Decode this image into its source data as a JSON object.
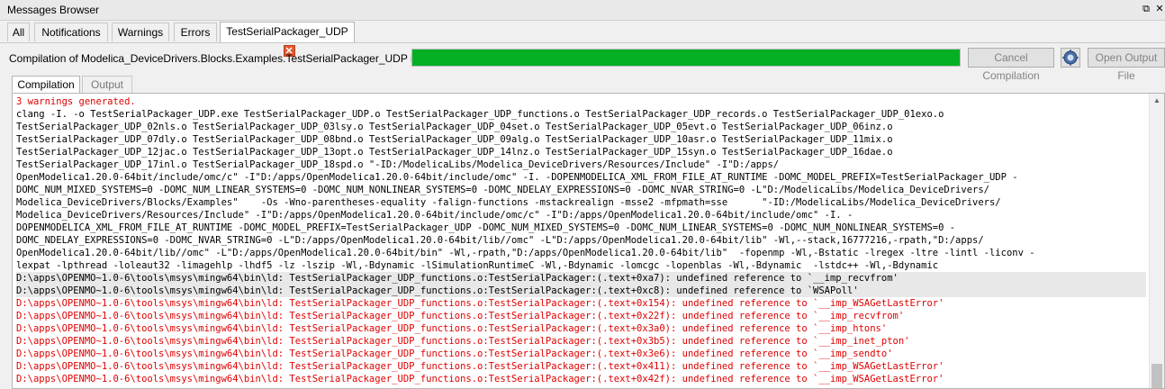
{
  "window": {
    "title": "Messages Browser"
  },
  "tabs": [
    {
      "label": "All"
    },
    {
      "label": "Notifications"
    },
    {
      "label": "Warnings"
    },
    {
      "label": "Errors"
    },
    {
      "label": "TestSerialPackager_UDP",
      "close_glyph": "✕"
    }
  ],
  "status": {
    "text": "Compilation of Modelica_DeviceDrivers.Blocks.Examples.TestSerialPackager_UDP is finished.",
    "progress_fraction": 1.0,
    "progress_color": "#06b025"
  },
  "buttons": {
    "cancel": "Cancel Compilation",
    "open_output": "Open Output File",
    "icon": "debug-icon"
  },
  "subtabs": [
    {
      "label": "Compilation"
    },
    {
      "label": "Output"
    }
  ],
  "colors": {
    "warning_text": "#e00000",
    "normal_text": "#000000"
  },
  "log": [
    {
      "text": "3 warnings generated.",
      "kind": "warn"
    },
    {
      "text": "clang -I. -o TestSerialPackager_UDP.exe TestSerialPackager_UDP.o TestSerialPackager_UDP_functions.o TestSerialPackager_UDP_records.o TestSerialPackager_UDP_01exo.o",
      "kind": "normal"
    },
    {
      "text": "TestSerialPackager_UDP_02nls.o TestSerialPackager_UDP_03lsy.o TestSerialPackager_UDP_04set.o TestSerialPackager_UDP_05evt.o TestSerialPackager_UDP_06inz.o",
      "kind": "normal"
    },
    {
      "text": "TestSerialPackager_UDP_07dly.o TestSerialPackager_UDP_08bnd.o TestSerialPackager_UDP_09alg.o TestSerialPackager_UDP_10asr.o TestSerialPackager_UDP_11mix.o",
      "kind": "normal"
    },
    {
      "text": "TestSerialPackager_UDP_12jac.o TestSerialPackager_UDP_13opt.o TestSerialPackager_UDP_14lnz.o TestSerialPackager_UDP_15syn.o TestSerialPackager_UDP_16dae.o",
      "kind": "normal"
    },
    {
      "text": "TestSerialPackager_UDP_17inl.o TestSerialPackager_UDP_18spd.o \"-ID:/ModelicaLibs/Modelica_DeviceDrivers/Resources/Include\" -I\"D:/apps/",
      "kind": "normal"
    },
    {
      "text": "OpenModelica1.20.0-64bit/include/omc/c\" -I\"D:/apps/OpenModelica1.20.0-64bit/include/omc\" -I. -DOPENMODELICA_XML_FROM_FILE_AT_RUNTIME -DOMC_MODEL_PREFIX=TestSerialPackager_UDP -",
      "kind": "normal"
    },
    {
      "text": "DOMC_NUM_MIXED_SYSTEMS=0 -DOMC_NUM_LINEAR_SYSTEMS=0 -DOMC_NUM_NONLINEAR_SYSTEMS=0 -DOMC_NDELAY_EXPRESSIONS=0 -DOMC_NVAR_STRING=0 -L\"D:/ModelicaLibs/Modelica_DeviceDrivers/",
      "kind": "normal"
    },
    {
      "text": "Modelica_DeviceDrivers/Blocks/Examples\"    -Os -Wno-parentheses-equality -falign-functions -mstackrealign -msse2 -mfpmath=sse      \"-ID:/ModelicaLibs/Modelica_DeviceDrivers/",
      "kind": "normal"
    },
    {
      "text": "Modelica_DeviceDrivers/Resources/Include\" -I\"D:/apps/OpenModelica1.20.0-64bit/include/omc/c\" -I\"D:/apps/OpenModelica1.20.0-64bit/include/omc\" -I. -",
      "kind": "normal"
    },
    {
      "text": "DOPENMODELICA_XML_FROM_FILE_AT_RUNTIME -DOMC_MODEL_PREFIX=TestSerialPackager_UDP -DOMC_NUM_MIXED_SYSTEMS=0 -DOMC_NUM_LINEAR_SYSTEMS=0 -DOMC_NUM_NONLINEAR_SYSTEMS=0 -",
      "kind": "normal"
    },
    {
      "text": "DOMC_NDELAY_EXPRESSIONS=0 -DOMC_NVAR_STRING=0 -L\"D:/apps/OpenModelica1.20.0-64bit/lib//omc\" -L\"D:/apps/OpenModelica1.20.0-64bit/lib\" -Wl,--stack,16777216,-rpath,\"D:/apps/",
      "kind": "normal"
    },
    {
      "text": "OpenModelica1.20.0-64bit/lib//omc\" -L\"D:/apps/OpenModelica1.20.0-64bit/bin\" -Wl,-rpath,\"D:/apps/OpenModelica1.20.0-64bit/lib\"  -fopenmp -Wl,-Bstatic -lregex -ltre -lintl -liconv -",
      "kind": "normal"
    },
    {
      "text": "lexpat -lpthread -loleaut32 -limagehlp -lhdf5 -lz -lszip -Wl,-Bdynamic -lSimulationRuntimeC -Wl,-Bdynamic -lomcgc -lopenblas -Wl,-Bdynamic  -lstdc++ -Wl,-Bdynamic",
      "kind": "normal"
    },
    {
      "text": "D:\\apps\\OPENMO~1.0-6\\tools\\msys\\mingw64\\bin\\ld: TestSerialPackager_UDP_functions.o:TestSerialPackager:(.text+0xa7): undefined reference to `__imp_recvfrom'",
      "kind": "sel"
    },
    {
      "text": "D:\\apps\\OPENMO~1.0-6\\tools\\msys\\mingw64\\bin\\ld: TestSerialPackager_UDP_functions.o:TestSerialPackager:(.text+0xc8): undefined reference to `WSAPoll'",
      "kind": "sel"
    },
    {
      "text": "D:\\apps\\OPENMO~1.0-6\\tools\\msys\\mingw64\\bin\\ld: TestSerialPackager_UDP_functions.o:TestSerialPackager:(.text+0x154): undefined reference to `__imp_WSAGetLastError'",
      "kind": "warn"
    },
    {
      "text": "D:\\apps\\OPENMO~1.0-6\\tools\\msys\\mingw64\\bin\\ld: TestSerialPackager_UDP_functions.o:TestSerialPackager:(.text+0x22f): undefined reference to `__imp_recvfrom'",
      "kind": "warn"
    },
    {
      "text": "D:\\apps\\OPENMO~1.0-6\\tools\\msys\\mingw64\\bin\\ld: TestSerialPackager_UDP_functions.o:TestSerialPackager:(.text+0x3a0): undefined reference to `__imp_htons'",
      "kind": "warn"
    },
    {
      "text": "D:\\apps\\OPENMO~1.0-6\\tools\\msys\\mingw64\\bin\\ld: TestSerialPackager_UDP_functions.o:TestSerialPackager:(.text+0x3b5): undefined reference to `__imp_inet_pton'",
      "kind": "warn"
    },
    {
      "text": "D:\\apps\\OPENMO~1.0-6\\tools\\msys\\mingw64\\bin\\ld: TestSerialPackager_UDP_functions.o:TestSerialPackager:(.text+0x3e6): undefined reference to `__imp_sendto'",
      "kind": "warn"
    },
    {
      "text": "D:\\apps\\OPENMO~1.0-6\\tools\\msys\\mingw64\\bin\\ld: TestSerialPackager_UDP_functions.o:TestSerialPackager:(.text+0x411): undefined reference to `__imp_WSAGetLastError'",
      "kind": "warn"
    },
    {
      "text": "D:\\apps\\OPENMO~1.0-6\\tools\\msys\\mingw64\\bin\\ld: TestSerialPackager_UDP_functions.o:TestSerialPackager:(.text+0x42f): undefined reference to `__imp_WSAGetLastError'",
      "kind": "warn"
    }
  ]
}
